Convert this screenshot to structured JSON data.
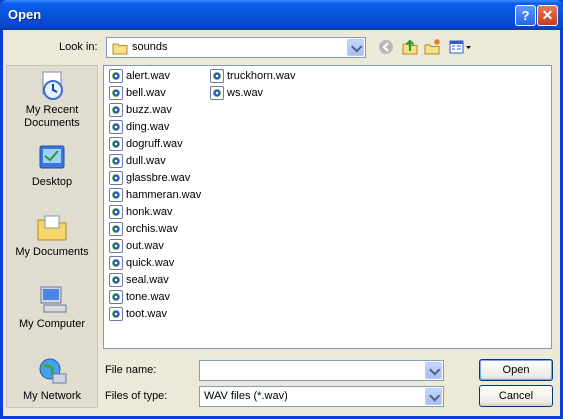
{
  "window": {
    "title": "Open",
    "help_label": "?",
    "close_label": "✕"
  },
  "lookin": {
    "label": "Look in:",
    "value": "sounds"
  },
  "toolbar": {
    "icons": [
      "back-icon",
      "up-folder-icon",
      "new-folder-icon",
      "views-menu-icon"
    ]
  },
  "places": [
    {
      "label": "My Recent Documents",
      "icon": "recent-documents-icon"
    },
    {
      "label": "Desktop",
      "icon": "desktop-icon"
    },
    {
      "label": "My Documents",
      "icon": "my-documents-icon"
    },
    {
      "label": "My Computer",
      "icon": "my-computer-icon"
    },
    {
      "label": "My Network",
      "icon": "my-network-icon"
    }
  ],
  "files": {
    "col1": [
      "alert.wav",
      "bell.wav",
      "buzz.wav",
      "ding.wav",
      "dogruff.wav",
      "dull.wav",
      "glassbre.wav",
      "hammeran.wav",
      "honk.wav",
      "orchis.wav",
      "out.wav",
      "quick.wav",
      "seal.wav",
      "tone.wav",
      "toot.wav"
    ],
    "col2": [
      "truckhorn.wav",
      "ws.wav"
    ]
  },
  "filename": {
    "label": "File name:",
    "value": ""
  },
  "filetype": {
    "label": "Files of type:",
    "value": "WAV files (*.wav)"
  },
  "buttons": {
    "open": "Open",
    "cancel": "Cancel"
  }
}
